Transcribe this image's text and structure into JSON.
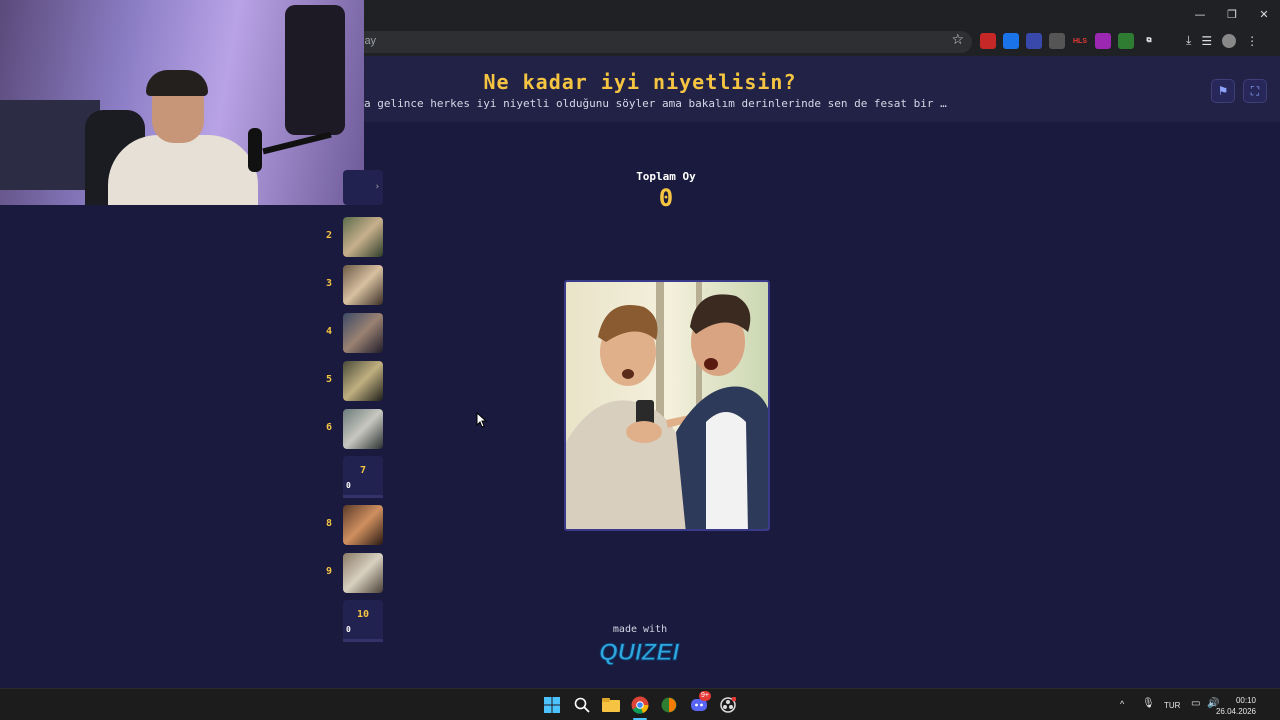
{
  "browser": {
    "url_fragment": "lay",
    "window_controls": {
      "minimize": "—",
      "restore": "❐",
      "close": "✕"
    },
    "extensions": [
      {
        "name": "extension-1-icon",
        "color": "#c62828",
        "label": ""
      },
      {
        "name": "translate-icon",
        "color": "#1a73e8",
        "label": ""
      },
      {
        "name": "extension-3-icon",
        "color": "#3949ab",
        "label": ""
      },
      {
        "name": "download-helper-icon",
        "color": "#555555",
        "label": ""
      },
      {
        "name": "hls-icon",
        "color": "#202124",
        "label": "HLS"
      },
      {
        "name": "extension-6-icon",
        "color": "#9c27b0",
        "label": ""
      },
      {
        "name": "extension-7-icon",
        "color": "#2e7d32",
        "label": ""
      },
      {
        "name": "puzzle-icon",
        "color": "#202124",
        "label": "⧉"
      }
    ]
  },
  "quiz": {
    "title": "Ne kadar iyi niyetlisin?",
    "subtitle": "a gelince herkes iyi niyetli olduğunu söyler ama bakalım derinlerinde sen de fesat bir …",
    "flag_icon": "⚑",
    "fullscreen_icon": "⛶"
  },
  "stats": {
    "label": "Toplam Oy",
    "value": "0"
  },
  "sidebar": {
    "items": [
      {
        "num": "2",
        "type": "image",
        "colors": [
          "#5a6b4a",
          "#c8b08c",
          "#2e3d2a"
        ]
      },
      {
        "num": "3",
        "type": "image",
        "colors": [
          "#6b5a48",
          "#d8c0a0",
          "#3a2e26"
        ]
      },
      {
        "num": "4",
        "type": "image",
        "colors": [
          "#3c4a66",
          "#9a8272",
          "#201c2a"
        ]
      },
      {
        "num": "5",
        "type": "image",
        "colors": [
          "#4a4a3a",
          "#c0b080",
          "#1e1e1a"
        ]
      },
      {
        "num": "6",
        "type": "image",
        "colors": [
          "#6a7a7a",
          "#c8c8c0",
          "#2a3030"
        ]
      },
      {
        "num": "7",
        "type": "card",
        "votes": "0"
      },
      {
        "num": "8",
        "type": "image",
        "colors": [
          "#5a3a2a",
          "#d09060",
          "#2a1a12"
        ]
      },
      {
        "num": "9",
        "type": "image",
        "colors": [
          "#8a7a66",
          "#d8d0c0",
          "#4a4036"
        ]
      },
      {
        "num": "10",
        "type": "card",
        "votes": "0"
      }
    ]
  },
  "footer": {
    "made_with": "made with",
    "brand": "QUIZEI"
  },
  "taskbar": {
    "language": "TUR",
    "time": "00:10",
    "date": "26.04.2026",
    "discord_badge": "9+"
  },
  "colors": {
    "background": "#1a1a3e",
    "accent": "#f5c542",
    "header": "#222247",
    "brand_blue": "#2fa8e0"
  }
}
